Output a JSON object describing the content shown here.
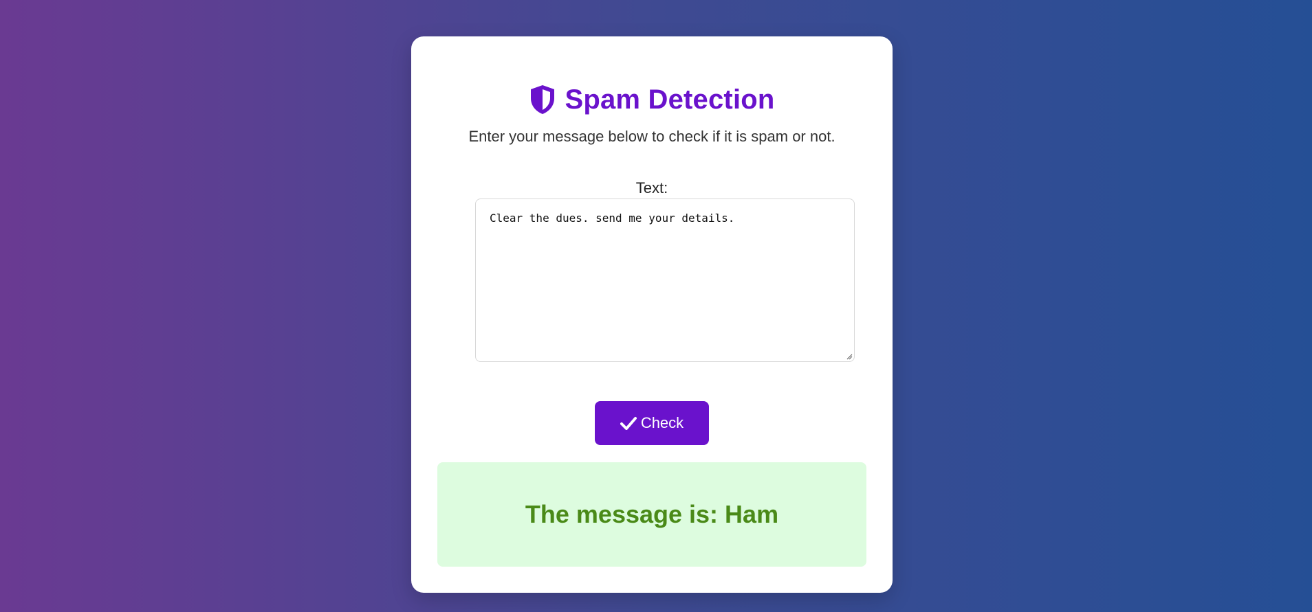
{
  "header": {
    "title": "Spam Detection",
    "subtitle": "Enter your message below to check if it is spam or not."
  },
  "form": {
    "label": "Text:",
    "message_value": "Clear the dues. send me your details.",
    "check_label": "Check"
  },
  "result": {
    "text": "The message is: Ham"
  },
  "icons": {
    "title_icon": "shield-icon",
    "button_icon": "checkmark-icon"
  },
  "colors": {
    "accent": "#6a12cc",
    "result_bg": "#ddfcdf",
    "result_text": "#4a8a18"
  }
}
